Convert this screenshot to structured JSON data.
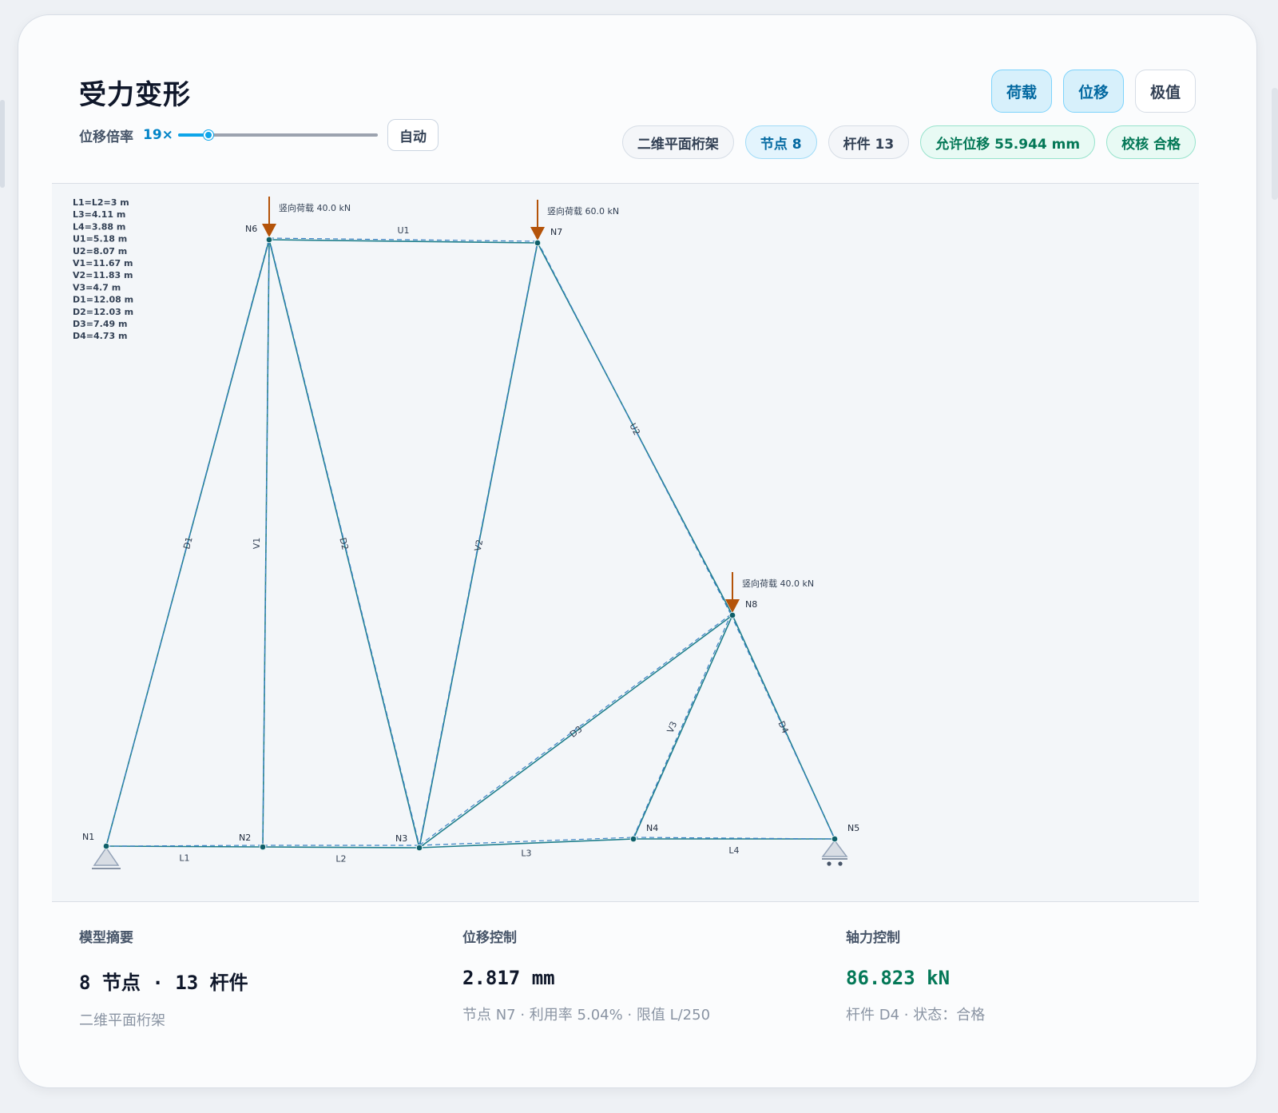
{
  "header": {
    "title": "受力变形",
    "scale_label": "位移倍率",
    "scale_value": "19×",
    "scale_fraction": 0.15,
    "auto_label": "自动"
  },
  "mode_tabs": [
    {
      "label": "荷载",
      "active": true
    },
    {
      "label": "位移",
      "active": true
    },
    {
      "label": "极值",
      "active": false
    }
  ],
  "chips": {
    "model_type": "二维平面桁架",
    "nodes": "节点 8",
    "members": "杆件 13",
    "allowable": "允许位移 55.944 mm",
    "check": "校核 合格"
  },
  "lengths_legend": [
    "L1=L2=3 m",
    "L3=4.11 m",
    "L4=3.88 m",
    "U1=5.18 m",
    "U2=8.07 m",
    "V1=11.67 m",
    "V2=11.83 m",
    "V3=4.7 m",
    "D1=12.08 m",
    "D2=12.03 m",
    "D3=7.49 m",
    "D4=4.73 m"
  ],
  "truss": {
    "nodes": [
      "N1",
      "N2",
      "N3",
      "N4",
      "N5",
      "N6",
      "N7",
      "N8"
    ],
    "members": [
      {
        "name": "L1",
        "from": "N1",
        "to": "N2"
      },
      {
        "name": "L2",
        "from": "N2",
        "to": "N3"
      },
      {
        "name": "L3",
        "from": "N3",
        "to": "N4"
      },
      {
        "name": "L4",
        "from": "N4",
        "to": "N5"
      },
      {
        "name": "U1",
        "from": "N6",
        "to": "N7"
      },
      {
        "name": "U2",
        "from": "N7",
        "to": "N8"
      },
      {
        "name": "V1",
        "from": "N2",
        "to": "N6"
      },
      {
        "name": "V2",
        "from": "N3",
        "to": "N7"
      },
      {
        "name": "V3",
        "from": "N4",
        "to": "N8"
      },
      {
        "name": "D1",
        "from": "N1",
        "to": "N6"
      },
      {
        "name": "D2",
        "from": "N6",
        "to": "N3"
      },
      {
        "name": "D3",
        "from": "N3",
        "to": "N8"
      },
      {
        "name": "D4",
        "from": "N8",
        "to": "N5"
      }
    ],
    "loads": [
      {
        "node": "N6",
        "label": "竖向荷载 40.0 kN"
      },
      {
        "node": "N7",
        "label": "竖向荷载 60.0 kN"
      },
      {
        "node": "N8",
        "label": "竖向荷载 40.0 kN"
      }
    ],
    "supports": [
      {
        "node": "N1",
        "type": "pin"
      },
      {
        "node": "N5",
        "type": "roller"
      }
    ]
  },
  "colors": {
    "member": "#1f7f8c",
    "deformed": "#3b82c4",
    "load": "#b45309",
    "support": "#94a3b8"
  },
  "summary": [
    {
      "title": "模型摘要",
      "value": "8 节点 · 13 杆件",
      "sub": "二维平面桁架",
      "accent": false
    },
    {
      "title": "位移控制",
      "value": "2.817 mm",
      "sub": "节点 N7 · 利用率 5.04% · 限值 L/250",
      "accent": false
    },
    {
      "title": "轴力控制",
      "value": "86.823 kN",
      "sub": "杆件 D4 · 状态：合格",
      "accent": true
    }
  ]
}
